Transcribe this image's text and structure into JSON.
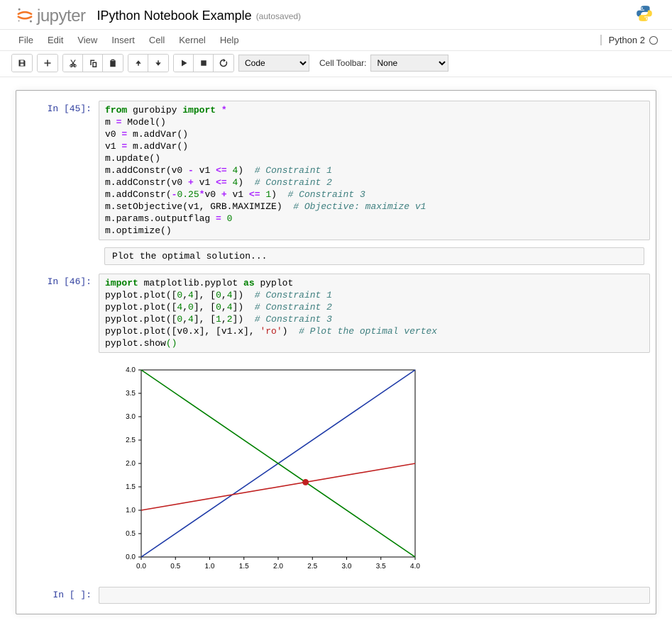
{
  "header": {
    "logo_text": "jupyter",
    "title": "IPython Notebook Example",
    "autosaved": "(autosaved)"
  },
  "menubar": {
    "items": [
      "File",
      "Edit",
      "View",
      "Insert",
      "Cell",
      "Kernel",
      "Help"
    ],
    "kernel_name": "Python 2"
  },
  "toolbar": {
    "cell_type_selected": "Code",
    "cell_toolbar_label": "Cell Toolbar:",
    "cell_toolbar_selected": "None"
  },
  "cells": {
    "c45": {
      "prompt": "In [45]:",
      "code": [
        {
          "t": "kw",
          "v": "from"
        },
        {
          "t": "p",
          "v": " gurobipy "
        },
        {
          "t": "kw",
          "v": "import"
        },
        {
          "t": "p",
          "v": " "
        },
        {
          "t": "op",
          "v": "*"
        },
        {
          "t": "br"
        },
        {
          "t": "p",
          "v": "m "
        },
        {
          "t": "op",
          "v": "="
        },
        {
          "t": "p",
          "v": " Model()"
        },
        {
          "t": "br"
        },
        {
          "t": "p",
          "v": "v0 "
        },
        {
          "t": "op",
          "v": "="
        },
        {
          "t": "p",
          "v": " m.addVar()"
        },
        {
          "t": "br"
        },
        {
          "t": "p",
          "v": "v1 "
        },
        {
          "t": "op",
          "v": "="
        },
        {
          "t": "p",
          "v": " m.addVar()"
        },
        {
          "t": "br"
        },
        {
          "t": "p",
          "v": "m.update()"
        },
        {
          "t": "br"
        },
        {
          "t": "p",
          "v": "m.addConstr(v0 "
        },
        {
          "t": "op",
          "v": "-"
        },
        {
          "t": "p",
          "v": " v1 "
        },
        {
          "t": "op",
          "v": "<="
        },
        {
          "t": "p",
          "v": " "
        },
        {
          "t": "num",
          "v": "4"
        },
        {
          "t": "p",
          "v": ")  "
        },
        {
          "t": "c",
          "v": "# Constraint 1"
        },
        {
          "t": "br"
        },
        {
          "t": "p",
          "v": "m.addConstr(v0 "
        },
        {
          "t": "op",
          "v": "+"
        },
        {
          "t": "p",
          "v": " v1 "
        },
        {
          "t": "op",
          "v": "<="
        },
        {
          "t": "p",
          "v": " "
        },
        {
          "t": "num",
          "v": "4"
        },
        {
          "t": "p",
          "v": ")  "
        },
        {
          "t": "c",
          "v": "# Constraint 2"
        },
        {
          "t": "br"
        },
        {
          "t": "p",
          "v": "m.addConstr("
        },
        {
          "t": "op",
          "v": "-"
        },
        {
          "t": "num",
          "v": "0.25"
        },
        {
          "t": "op",
          "v": "*"
        },
        {
          "t": "p",
          "v": "v0 "
        },
        {
          "t": "op",
          "v": "+"
        },
        {
          "t": "p",
          "v": " v1 "
        },
        {
          "t": "op",
          "v": "<="
        },
        {
          "t": "p",
          "v": " "
        },
        {
          "t": "num",
          "v": "1"
        },
        {
          "t": "p",
          "v": ")  "
        },
        {
          "t": "c",
          "v": "# Constraint 3"
        },
        {
          "t": "br"
        },
        {
          "t": "p",
          "v": "m.setObjective(v1, GRB.MAXIMIZE)  "
        },
        {
          "t": "c",
          "v": "# Objective: maximize v1"
        },
        {
          "t": "br"
        },
        {
          "t": "p",
          "v": "m.params.outputflag "
        },
        {
          "t": "op",
          "v": "="
        },
        {
          "t": "p",
          "v": " "
        },
        {
          "t": "num",
          "v": "0"
        },
        {
          "t": "br"
        },
        {
          "t": "p",
          "v": "m.optimize()"
        }
      ],
      "stdout": "Plot the optimal solution..."
    },
    "c46": {
      "prompt": "In [46]:",
      "code": [
        {
          "t": "kw",
          "v": "import"
        },
        {
          "t": "p",
          "v": " matplotlib.pyplot "
        },
        {
          "t": "kw",
          "v": "as"
        },
        {
          "t": "p",
          "v": " pyplot"
        },
        {
          "t": "br"
        },
        {
          "t": "p",
          "v": "pyplot.plot(["
        },
        {
          "t": "num",
          "v": "0"
        },
        {
          "t": "p",
          "v": ","
        },
        {
          "t": "num",
          "v": "4"
        },
        {
          "t": "p",
          "v": "], ["
        },
        {
          "t": "num",
          "v": "0"
        },
        {
          "t": "p",
          "v": ","
        },
        {
          "t": "num",
          "v": "4"
        },
        {
          "t": "p",
          "v": "])  "
        },
        {
          "t": "c",
          "v": "# Constraint 1"
        },
        {
          "t": "br"
        },
        {
          "t": "p",
          "v": "pyplot.plot(["
        },
        {
          "t": "num",
          "v": "4"
        },
        {
          "t": "p",
          "v": ","
        },
        {
          "t": "num",
          "v": "0"
        },
        {
          "t": "p",
          "v": "], ["
        },
        {
          "t": "num",
          "v": "0"
        },
        {
          "t": "p",
          "v": ","
        },
        {
          "t": "num",
          "v": "4"
        },
        {
          "t": "p",
          "v": "])  "
        },
        {
          "t": "c",
          "v": "# Constraint 2"
        },
        {
          "t": "br"
        },
        {
          "t": "p",
          "v": "pyplot.plot(["
        },
        {
          "t": "num",
          "v": "0"
        },
        {
          "t": "p",
          "v": ","
        },
        {
          "t": "num",
          "v": "4"
        },
        {
          "t": "p",
          "v": "], ["
        },
        {
          "t": "num",
          "v": "1"
        },
        {
          "t": "p",
          "v": ","
        },
        {
          "t": "num",
          "v": "2"
        },
        {
          "t": "p",
          "v": "])  "
        },
        {
          "t": "c",
          "v": "# Constraint 3"
        },
        {
          "t": "br"
        },
        {
          "t": "p",
          "v": "pyplot.plot([v0.x], [v1.x], "
        },
        {
          "t": "str",
          "v": "'ro'"
        },
        {
          "t": "p",
          "v": ")  "
        },
        {
          "t": "c",
          "v": "# Plot the optimal vertex"
        },
        {
          "t": "br"
        },
        {
          "t": "p",
          "v": "pyplot.show"
        },
        {
          "t": "num",
          "v": "()"
        }
      ]
    },
    "empty": {
      "prompt": "In [ ]:"
    }
  },
  "chart_data": {
    "type": "line",
    "xlim": [
      0.0,
      4.0
    ],
    "ylim": [
      0.0,
      4.0
    ],
    "xticks": [
      0.0,
      0.5,
      1.0,
      1.5,
      2.0,
      2.5,
      3.0,
      3.5,
      4.0
    ],
    "yticks": [
      0.0,
      0.5,
      1.0,
      1.5,
      2.0,
      2.5,
      3.0,
      3.5,
      4.0
    ],
    "series": [
      {
        "name": "Constraint 1",
        "color": "#1f3ba8",
        "x": [
          0,
          4
        ],
        "y": [
          0,
          4
        ]
      },
      {
        "name": "Constraint 2",
        "color": "#008000",
        "x": [
          4,
          0
        ],
        "y": [
          0,
          4
        ]
      },
      {
        "name": "Constraint 3",
        "color": "#c02020",
        "x": [
          0,
          4
        ],
        "y": [
          1,
          2
        ]
      }
    ],
    "points": [
      {
        "name": "Optimal vertex",
        "color": "#c02020",
        "x": 2.4,
        "y": 1.6
      }
    ]
  }
}
